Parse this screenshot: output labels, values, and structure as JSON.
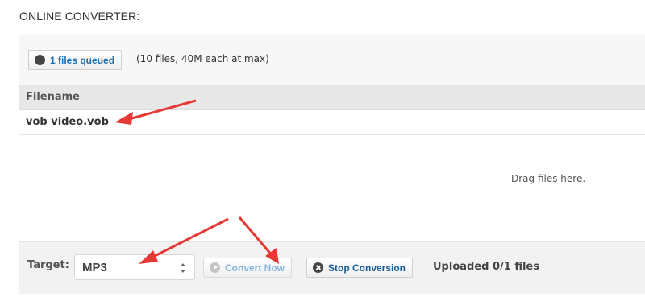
{
  "section_title": "ONLINE CONVERTER:",
  "toolbar": {
    "files_queued_label": "1 files queued",
    "limit_note": "(10 files, 40M each at max)"
  },
  "table": {
    "header": "Filename",
    "rows": [
      {
        "filename": "vob video.vob"
      }
    ]
  },
  "drop_zone": {
    "text": "Drag files here."
  },
  "bottom_bar": {
    "target_label": "Target:",
    "target_value": "MP3",
    "convert_now_label": "Convert Now",
    "stop_conversion_label": "Stop Conversion",
    "upload_status": "Uploaded 0/1 files"
  },
  "colors": {
    "annotation_arrow": "#e53935",
    "link_blue": "#1a6fb5"
  }
}
